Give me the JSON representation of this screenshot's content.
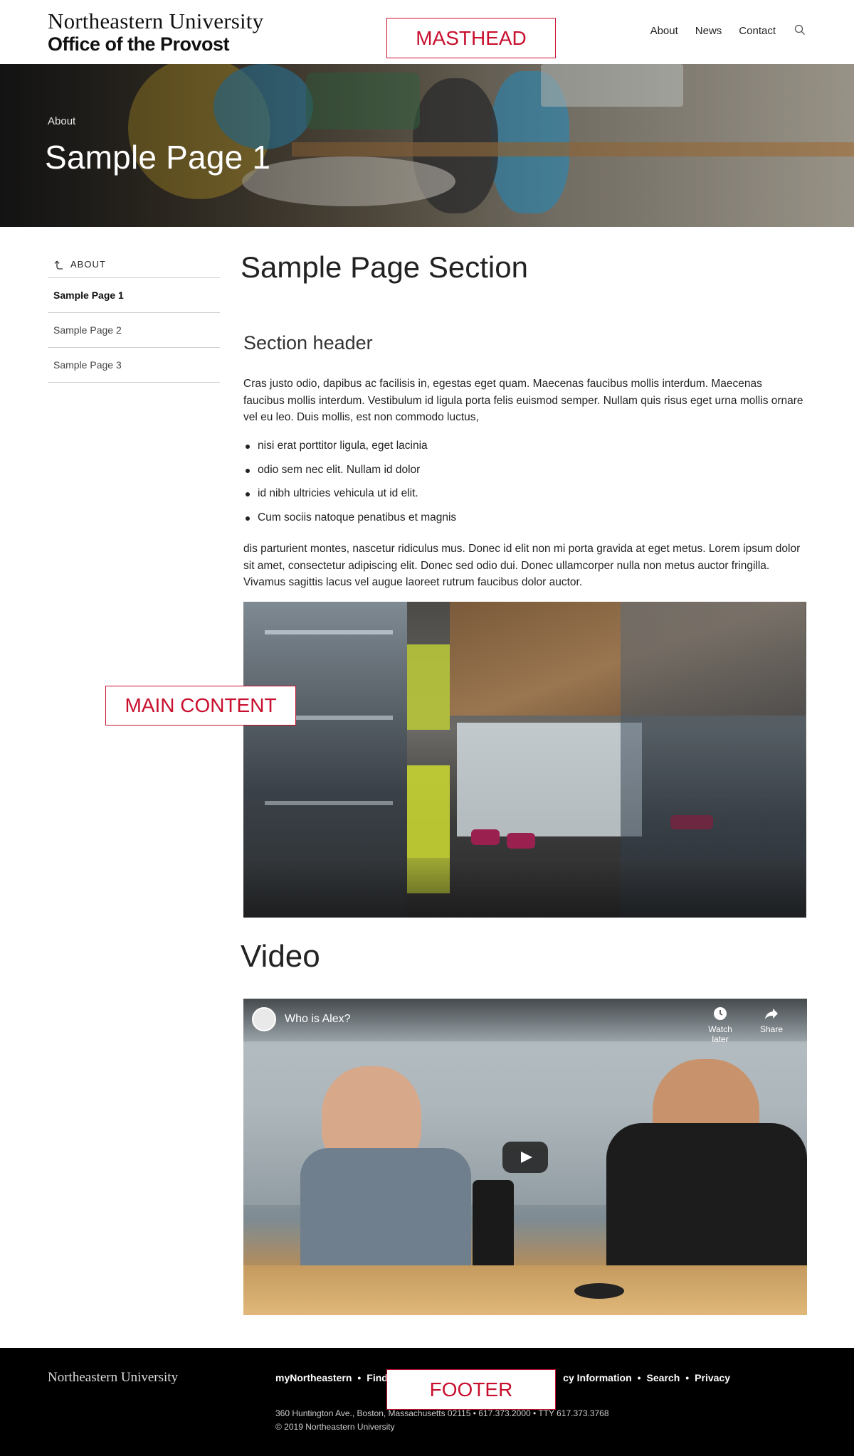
{
  "header": {
    "logo_line1": "Northeastern University",
    "logo_line2": "Office of the Provost",
    "nav": [
      "About",
      "News",
      "Contact"
    ],
    "search_icon": "search-icon"
  },
  "overlay_labels": {
    "masthead": "MASTHEAD",
    "main_content": "MAIN CONTENT",
    "footer": "FOOTER"
  },
  "hero": {
    "breadcrumb": "About",
    "title": "Sample Page 1"
  },
  "sidebar": {
    "parent_label": "ABOUT",
    "items": [
      "Sample Page 1",
      "Sample Page 2",
      "Sample Page 3"
    ],
    "active_index": 0
  },
  "main": {
    "heading": "Sample Page Section",
    "section_header": "Section header",
    "paragraph1": "Cras justo odio, dapibus ac facilisis in, egestas eget quam. Maecenas faucibus mollis interdum. Maecenas faucibus mollis interdum. Vestibulum id ligula porta felis euismod semper. Nullam quis risus eget urna mollis ornare vel eu leo. Duis mollis, est non commodo luctus,",
    "bullets": [
      "nisi erat porttitor ligula, eget lacinia",
      "odio sem nec elit. Nullam id dolor",
      "id nibh ultricies vehicula ut id elit.",
      "Cum sociis natoque penatibus et magnis"
    ],
    "paragraph2": "dis parturient montes, nascetur ridiculus mus. Donec id elit non mi porta gravida at eget metus. Lorem ipsum dolor sit amet, consectetur adipiscing elit. Donec sed odio dui. Donec ullamcorper nulla non metus auctor fringilla. Vivamus sagittis lacus vel augue laoreet rutrum faucibus dolor auctor.",
    "video_heading": "Video"
  },
  "video": {
    "title": "Who is Alex?",
    "watch_later": "Watch later",
    "share": "Share"
  },
  "footer": {
    "logo": "Northeastern University",
    "links": [
      "myNortheastern",
      "Find F",
      "cy Information",
      "Search",
      "Privacy"
    ],
    "address": "360 Huntington Ave., Boston, Massachusetts 02115  •  617.373.2000  •  TTY 617.373.3768",
    "copyright": "© 2019 Northeastern University"
  }
}
